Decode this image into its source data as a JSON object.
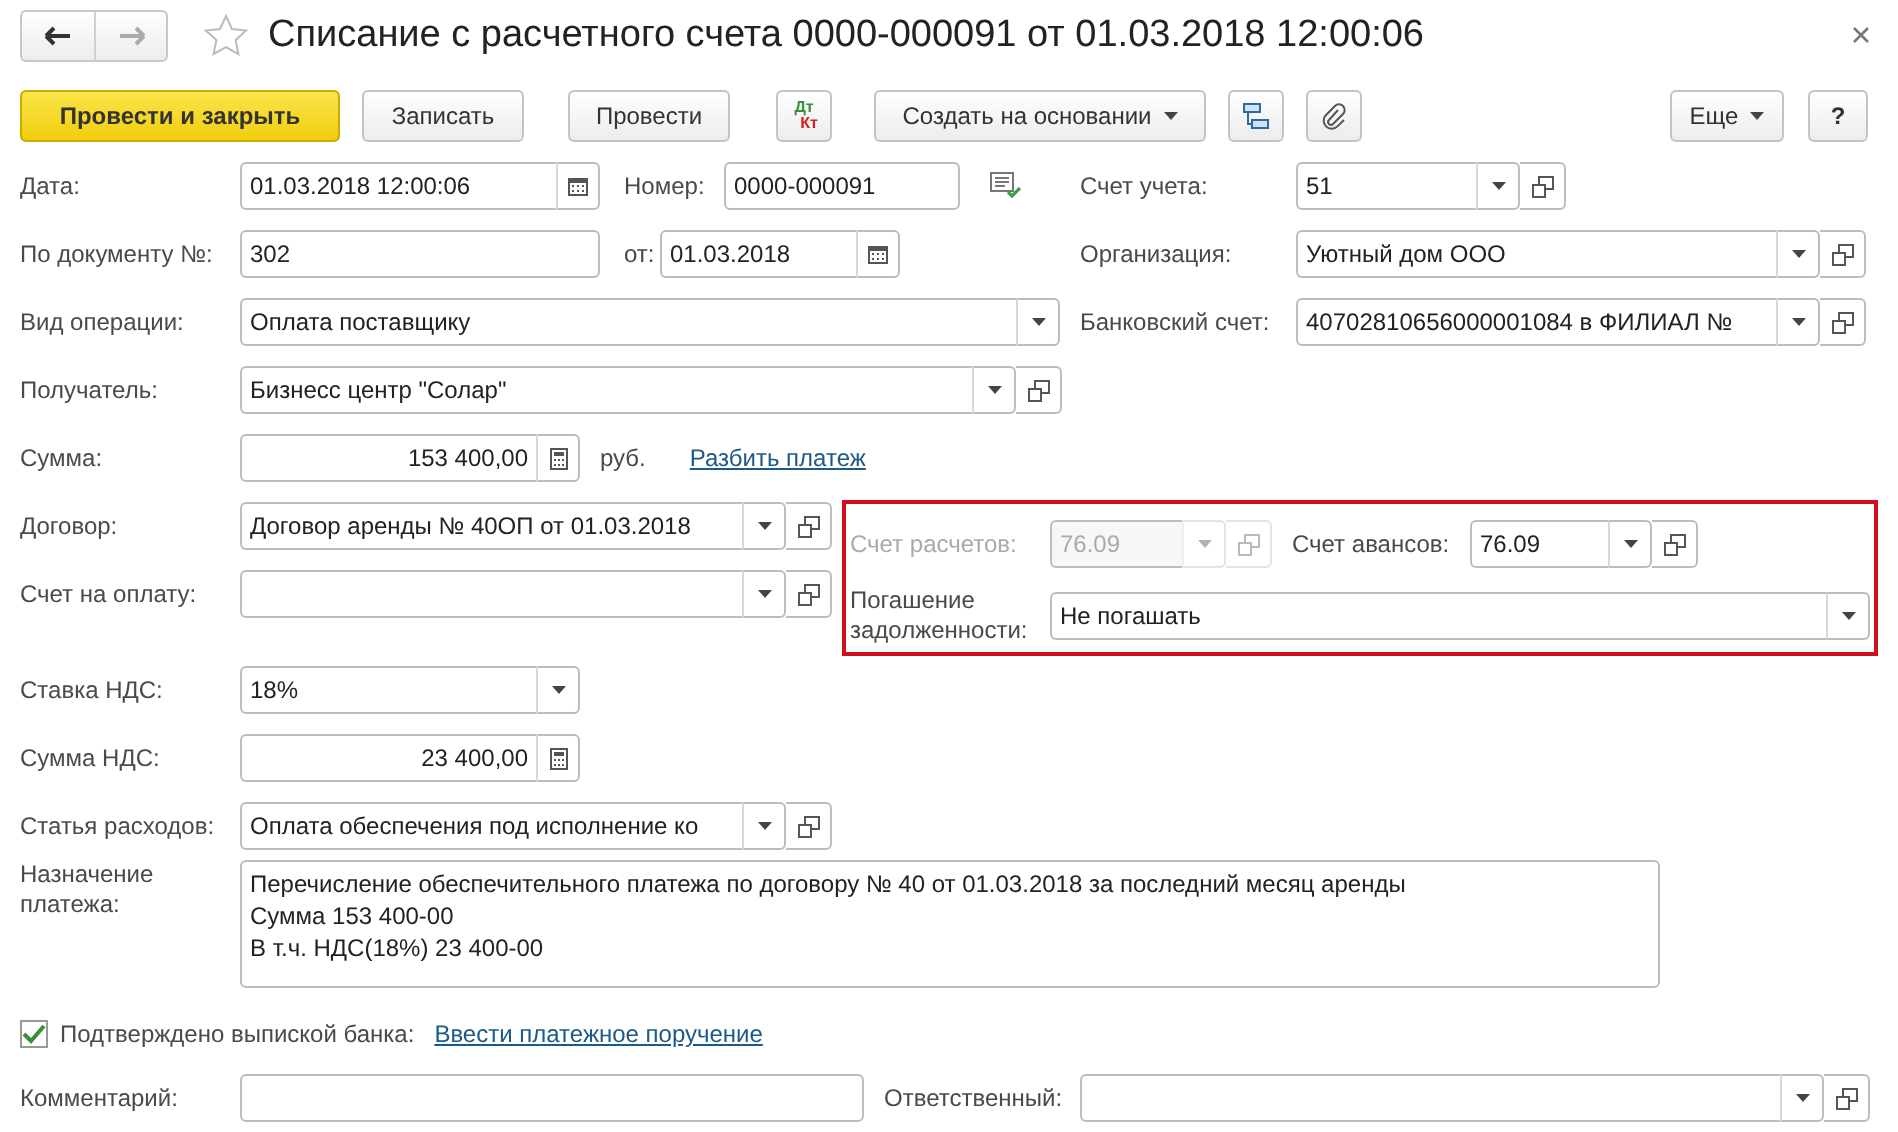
{
  "window": {
    "title": "Списание с расчетного счета 0000-000091 от 01.03.2018 12:00:06"
  },
  "toolbar": {
    "post_close": "Провести и закрыть",
    "save": "Записать",
    "post": "Провести",
    "dt": "Дт",
    "kt": "Кт",
    "create_based": "Создать на основании",
    "more": "Еще",
    "help": "?"
  },
  "form": {
    "date": {
      "label": "Дата:",
      "value": "01.03.2018 12:00:06",
      "kind": "date"
    },
    "doc_number": {
      "label": "Номер:",
      "value": "0000-000091",
      "kind": "text"
    },
    "account": {
      "label": "Счет учета:",
      "value": "51",
      "kind": "ref"
    },
    "incoming_number": {
      "label": "По документу №:",
      "value": "302",
      "kind": "text"
    },
    "incoming_date": {
      "label": "от:",
      "value": "01.03.2018",
      "kind": "date"
    },
    "organization": {
      "label": "Организация:",
      "value": "Уютный дом ООО",
      "kind": "ref"
    },
    "operation": {
      "label": "Вид операции:",
      "value": "Оплата поставщику",
      "kind": "choice"
    },
    "bank_account": {
      "label": "Банковский счет:",
      "value": "40702810656000001084 в ФИЛИАЛ №",
      "kind": "ref"
    },
    "recipient": {
      "label": "Получатель:",
      "value": "Бизнесс центр \"Солар\"",
      "kind": "ref"
    },
    "amount": {
      "label": "Сумма:",
      "value": "153 400,00",
      "kind": "number",
      "currency": "руб.",
      "link": "Разбить платеж"
    },
    "contract": {
      "label": "Договор:",
      "value": "Договор аренды № 40ОП от 01.03.2018",
      "kind": "ref"
    },
    "invoice": {
      "label": "Счет на оплату:",
      "kind": "ref"
    },
    "settlement_account": {
      "label": "Счет расчетов:",
      "value": "76.09",
      "kind": "ref",
      "disabled": true
    },
    "advance_account": {
      "label": "Счет авансов:",
      "value": "76.09",
      "kind": "ref",
      "disabled": false
    },
    "debt_repayment": {
      "label": "Погашение задолженности:",
      "value": "Не погашать",
      "kind": "choice"
    },
    "vat_rate": {
      "label": "Ставка НДС:",
      "value": "18%",
      "kind": "choice"
    },
    "vat_amount": {
      "label": "Сумма НДС:",
      "value": "23 400,00",
      "kind": "number"
    },
    "expense_item": {
      "label": "Статья расходов:",
      "value": "Оплата обеспечения под исполнение ко",
      "kind": "ref"
    },
    "purpose": {
      "label": "Назначение платежа:",
      "lines": [
        "Перечисление обеспечительного платежа по договору № 40 от 01.03.2018 за последний месяц аренды",
        "Сумма 153 400-00",
        "В т.ч. НДС(18%) 23 400-00"
      ]
    },
    "confirmed": {
      "label": "Подтверждено выпиской банка:",
      "checked": true,
      "link": "Ввести платежное поручение"
    },
    "comment": {
      "label": "Комментарий:",
      "kind": "text"
    },
    "responsible": {
      "label": "Ответственный:",
      "kind": "ref"
    }
  }
}
